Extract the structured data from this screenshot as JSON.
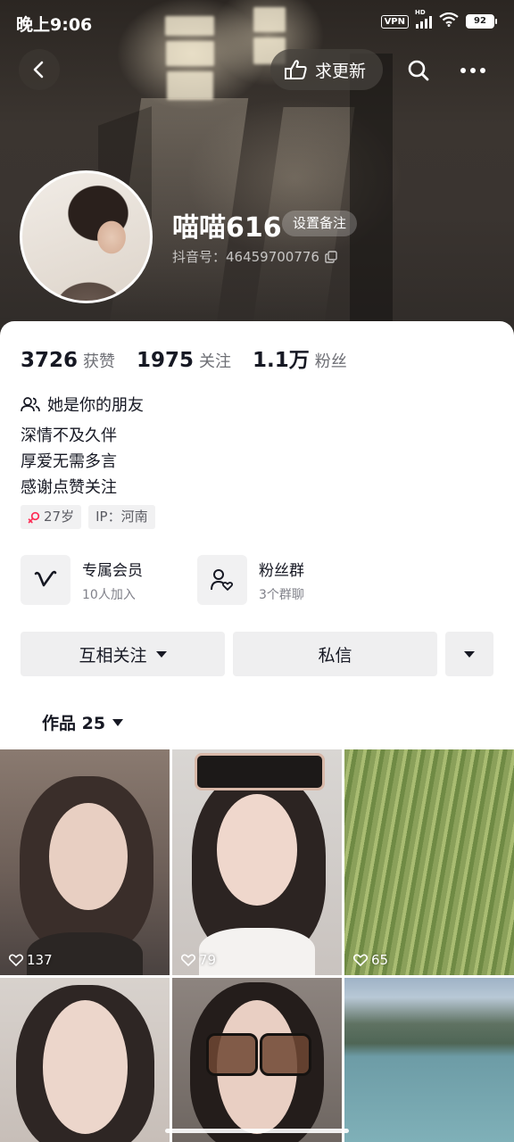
{
  "status_bar": {
    "time": "晚上9:06",
    "vpn": "VPN",
    "network": "HD",
    "battery": "92"
  },
  "nav": {
    "request_update_label": "求更新"
  },
  "profile": {
    "nickname": "喵喵616",
    "remark_button": "设置备注",
    "douyin_id": "抖音号：46459700776"
  },
  "stats": [
    {
      "value": "3726",
      "label": "获赞"
    },
    {
      "value": "1975",
      "label": "关注"
    },
    {
      "value": "1.1万",
      "label": "粉丝"
    }
  ],
  "friend_label": "她是你的朋友",
  "bio": [
    "深情不及久伴",
    "厚爱无需多言",
    "感谢点赞关注"
  ],
  "tags": {
    "age": "27岁",
    "ip": "IP：河南"
  },
  "features": [
    {
      "title": "专属会员",
      "subtitle": "10人加入"
    },
    {
      "title": "粉丝群",
      "subtitle": "3个群聊"
    }
  ],
  "actions": {
    "follow": "互相关注",
    "message": "私信"
  },
  "works_tab": "作品 25",
  "works": [
    {
      "likes": "137"
    },
    {
      "likes": "79"
    },
    {
      "likes": "65"
    },
    {
      "likes": ""
    },
    {
      "likes": ""
    },
    {
      "likes": ""
    }
  ],
  "colors": {
    "text_primary": "#161823",
    "text_secondary": "#6e6f75",
    "chip_bg": "#f1f1f2",
    "female_icon": "#fe2c55"
  }
}
